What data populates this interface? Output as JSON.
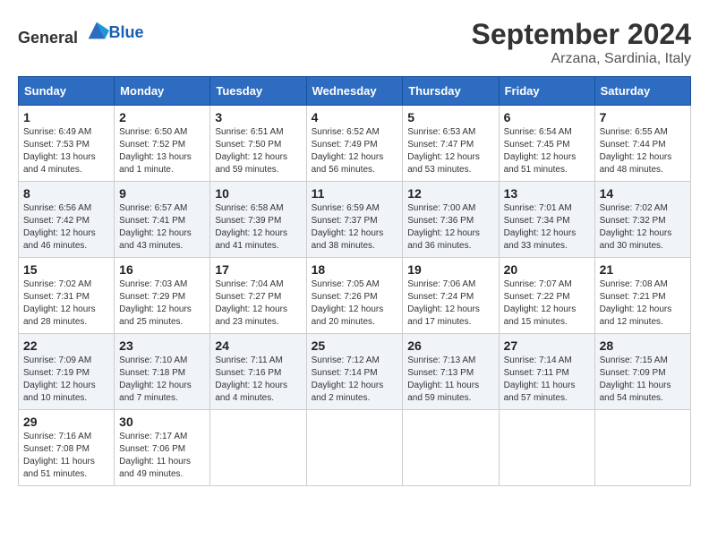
{
  "header": {
    "logo_general": "General",
    "logo_blue": "Blue",
    "month_title": "September 2024",
    "location": "Arzana, Sardinia, Italy"
  },
  "weekdays": [
    "Sunday",
    "Monday",
    "Tuesday",
    "Wednesday",
    "Thursday",
    "Friday",
    "Saturday"
  ],
  "weeks": [
    [
      {
        "day": "1",
        "sunrise": "Sunrise: 6:49 AM",
        "sunset": "Sunset: 7:53 PM",
        "daylight": "Daylight: 13 hours and 4 minutes."
      },
      {
        "day": "2",
        "sunrise": "Sunrise: 6:50 AM",
        "sunset": "Sunset: 7:52 PM",
        "daylight": "Daylight: 13 hours and 1 minute."
      },
      {
        "day": "3",
        "sunrise": "Sunrise: 6:51 AM",
        "sunset": "Sunset: 7:50 PM",
        "daylight": "Daylight: 12 hours and 59 minutes."
      },
      {
        "day": "4",
        "sunrise": "Sunrise: 6:52 AM",
        "sunset": "Sunset: 7:49 PM",
        "daylight": "Daylight: 12 hours and 56 minutes."
      },
      {
        "day": "5",
        "sunrise": "Sunrise: 6:53 AM",
        "sunset": "Sunset: 7:47 PM",
        "daylight": "Daylight: 12 hours and 53 minutes."
      },
      {
        "day": "6",
        "sunrise": "Sunrise: 6:54 AM",
        "sunset": "Sunset: 7:45 PM",
        "daylight": "Daylight: 12 hours and 51 minutes."
      },
      {
        "day": "7",
        "sunrise": "Sunrise: 6:55 AM",
        "sunset": "Sunset: 7:44 PM",
        "daylight": "Daylight: 12 hours and 48 minutes."
      }
    ],
    [
      {
        "day": "8",
        "sunrise": "Sunrise: 6:56 AM",
        "sunset": "Sunset: 7:42 PM",
        "daylight": "Daylight: 12 hours and 46 minutes."
      },
      {
        "day": "9",
        "sunrise": "Sunrise: 6:57 AM",
        "sunset": "Sunset: 7:41 PM",
        "daylight": "Daylight: 12 hours and 43 minutes."
      },
      {
        "day": "10",
        "sunrise": "Sunrise: 6:58 AM",
        "sunset": "Sunset: 7:39 PM",
        "daylight": "Daylight: 12 hours and 41 minutes."
      },
      {
        "day": "11",
        "sunrise": "Sunrise: 6:59 AM",
        "sunset": "Sunset: 7:37 PM",
        "daylight": "Daylight: 12 hours and 38 minutes."
      },
      {
        "day": "12",
        "sunrise": "Sunrise: 7:00 AM",
        "sunset": "Sunset: 7:36 PM",
        "daylight": "Daylight: 12 hours and 36 minutes."
      },
      {
        "day": "13",
        "sunrise": "Sunrise: 7:01 AM",
        "sunset": "Sunset: 7:34 PM",
        "daylight": "Daylight: 12 hours and 33 minutes."
      },
      {
        "day": "14",
        "sunrise": "Sunrise: 7:02 AM",
        "sunset": "Sunset: 7:32 PM",
        "daylight": "Daylight: 12 hours and 30 minutes."
      }
    ],
    [
      {
        "day": "15",
        "sunrise": "Sunrise: 7:02 AM",
        "sunset": "Sunset: 7:31 PM",
        "daylight": "Daylight: 12 hours and 28 minutes."
      },
      {
        "day": "16",
        "sunrise": "Sunrise: 7:03 AM",
        "sunset": "Sunset: 7:29 PM",
        "daylight": "Daylight: 12 hours and 25 minutes."
      },
      {
        "day": "17",
        "sunrise": "Sunrise: 7:04 AM",
        "sunset": "Sunset: 7:27 PM",
        "daylight": "Daylight: 12 hours and 23 minutes."
      },
      {
        "day": "18",
        "sunrise": "Sunrise: 7:05 AM",
        "sunset": "Sunset: 7:26 PM",
        "daylight": "Daylight: 12 hours and 20 minutes."
      },
      {
        "day": "19",
        "sunrise": "Sunrise: 7:06 AM",
        "sunset": "Sunset: 7:24 PM",
        "daylight": "Daylight: 12 hours and 17 minutes."
      },
      {
        "day": "20",
        "sunrise": "Sunrise: 7:07 AM",
        "sunset": "Sunset: 7:22 PM",
        "daylight": "Daylight: 12 hours and 15 minutes."
      },
      {
        "day": "21",
        "sunrise": "Sunrise: 7:08 AM",
        "sunset": "Sunset: 7:21 PM",
        "daylight": "Daylight: 12 hours and 12 minutes."
      }
    ],
    [
      {
        "day": "22",
        "sunrise": "Sunrise: 7:09 AM",
        "sunset": "Sunset: 7:19 PM",
        "daylight": "Daylight: 12 hours and 10 minutes."
      },
      {
        "day": "23",
        "sunrise": "Sunrise: 7:10 AM",
        "sunset": "Sunset: 7:18 PM",
        "daylight": "Daylight: 12 hours and 7 minutes."
      },
      {
        "day": "24",
        "sunrise": "Sunrise: 7:11 AM",
        "sunset": "Sunset: 7:16 PM",
        "daylight": "Daylight: 12 hours and 4 minutes."
      },
      {
        "day": "25",
        "sunrise": "Sunrise: 7:12 AM",
        "sunset": "Sunset: 7:14 PM",
        "daylight": "Daylight: 12 hours and 2 minutes."
      },
      {
        "day": "26",
        "sunrise": "Sunrise: 7:13 AM",
        "sunset": "Sunset: 7:13 PM",
        "daylight": "Daylight: 11 hours and 59 minutes."
      },
      {
        "day": "27",
        "sunrise": "Sunrise: 7:14 AM",
        "sunset": "Sunset: 7:11 PM",
        "daylight": "Daylight: 11 hours and 57 minutes."
      },
      {
        "day": "28",
        "sunrise": "Sunrise: 7:15 AM",
        "sunset": "Sunset: 7:09 PM",
        "daylight": "Daylight: 11 hours and 54 minutes."
      }
    ],
    [
      {
        "day": "29",
        "sunrise": "Sunrise: 7:16 AM",
        "sunset": "Sunset: 7:08 PM",
        "daylight": "Daylight: 11 hours and 51 minutes."
      },
      {
        "day": "30",
        "sunrise": "Sunrise: 7:17 AM",
        "sunset": "Sunset: 7:06 PM",
        "daylight": "Daylight: 11 hours and 49 minutes."
      },
      null,
      null,
      null,
      null,
      null
    ]
  ]
}
